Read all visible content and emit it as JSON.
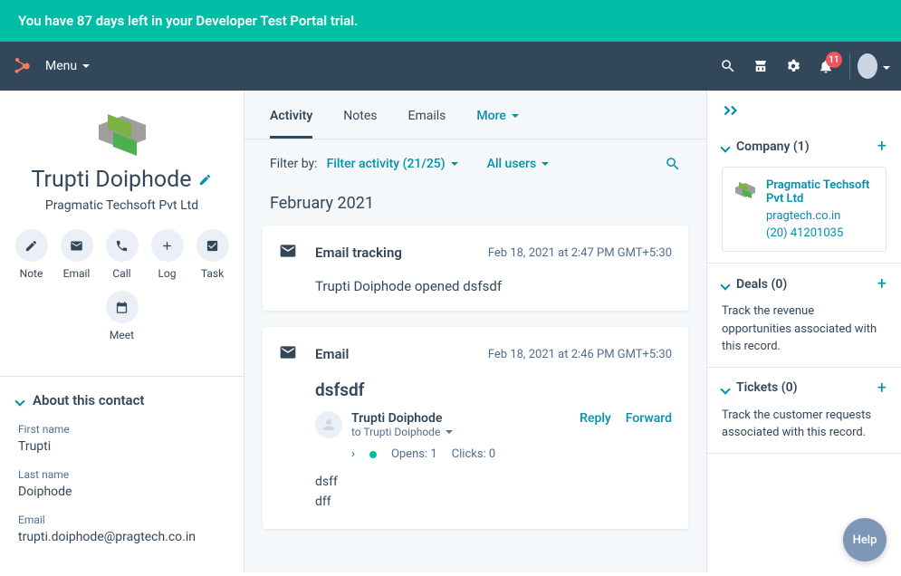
{
  "banner": {
    "text": "You have 87 days left in your Developer Test Portal trial."
  },
  "nav": {
    "menu": "Menu",
    "notification_count": "11"
  },
  "contact": {
    "name": "Trupti Doiphode",
    "company": "Pragmatic Techsoft Pvt Ltd",
    "actions": {
      "note": "Note",
      "email": "Email",
      "call": "Call",
      "log": "Log",
      "task": "Task",
      "meet": "Meet"
    },
    "about_title": "About this contact",
    "fields": {
      "first_name_label": "First name",
      "first_name_value": "Trupti",
      "last_name_label": "Last name",
      "last_name_value": "Doiphode",
      "email_label": "Email",
      "email_value": "trupti.doiphode@pragtech.co.in"
    }
  },
  "tabs": {
    "activity": "Activity",
    "notes": "Notes",
    "emails": "Emails",
    "more": "More"
  },
  "filters": {
    "label": "Filter by:",
    "activity": "Filter activity (21/25)",
    "users": "All users"
  },
  "timeline": {
    "month": "February 2021",
    "card1": {
      "title": "Email tracking",
      "time": "Feb 18, 2021 at 2:47 PM GMT+5:30",
      "body": "Trupti Doiphode opened dsfsdf"
    },
    "card2": {
      "title": "Email",
      "time": "Feb 18, 2021 at 2:46 PM GMT+5:30",
      "subject": "dsfsdf",
      "sender": "Trupti Doiphode",
      "recipient": "to Trupti Doiphode",
      "reply": "Reply",
      "forward": "Forward",
      "opens": "Opens: 1",
      "clicks": "Clicks: 0",
      "line1": "dsff",
      "line2": "dff"
    }
  },
  "right": {
    "company": {
      "title": "Company (1)",
      "name": "Pragmatic Techsoft Pvt Ltd",
      "url": "pragtech.co.in",
      "phone": "(20) 41201035"
    },
    "deals": {
      "title": "Deals (0)",
      "desc": "Track the revenue opportunities associated with this record."
    },
    "tickets": {
      "title": "Tickets (0)",
      "desc": "Track the customer requests associated with this record."
    }
  },
  "help": "Help"
}
